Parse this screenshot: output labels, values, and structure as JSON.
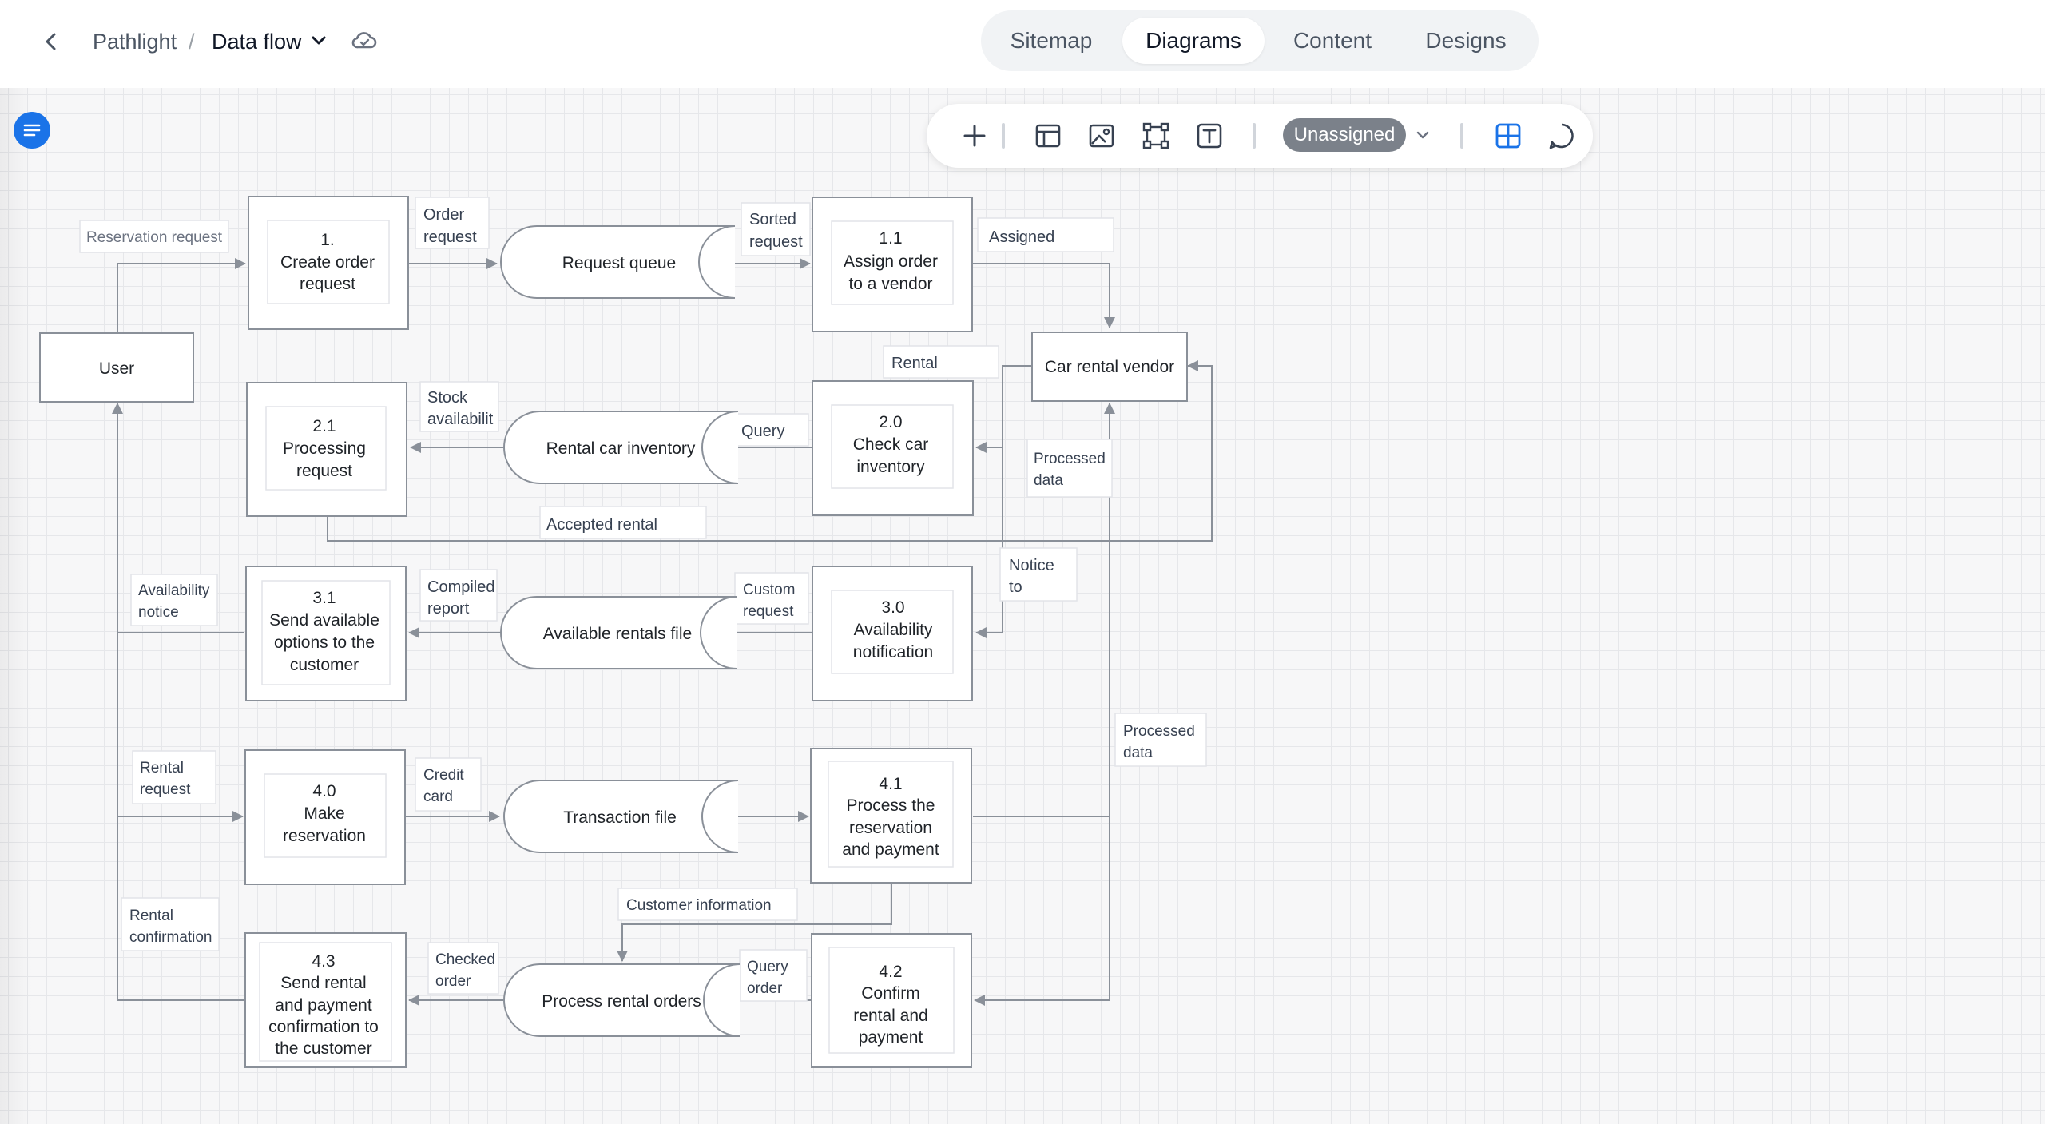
{
  "header": {
    "project": "Pathlight",
    "separator": "/",
    "current": "Data flow"
  },
  "tabs": [
    {
      "label": "Sitemap",
      "active": false
    },
    {
      "label": "Diagrams",
      "active": true
    },
    {
      "label": "Content",
      "active": false
    },
    {
      "label": "Designs",
      "active": false
    }
  ],
  "toolbar": {
    "assignee": "Unassigned",
    "icons": [
      "plus-icon",
      "layout-icon",
      "image-icon",
      "frame-icon",
      "text-icon",
      "grid-icon",
      "comment-icon"
    ]
  },
  "colors": {
    "accent": "#1a73e8",
    "edge": "#8a9099",
    "node_border": "#8a9099",
    "pill": "#7b818a"
  },
  "diagram": {
    "entities": {
      "user": "User",
      "vendor": "Car rental vendor"
    },
    "processes": {
      "p1": [
        "1.",
        "Create order",
        "request"
      ],
      "p11": [
        "1.1",
        "Assign order",
        "to a vendor"
      ],
      "p21": [
        "2.1",
        "Processing",
        "request"
      ],
      "p20": [
        "2.0",
        "Check car",
        "inventory"
      ],
      "p31": [
        "3.1",
        "Send available",
        "options to the",
        "customer"
      ],
      "p30": [
        "3.0",
        "Availability",
        "notification"
      ],
      "p40": [
        "4.0",
        "Make",
        "reservation"
      ],
      "p41": [
        "4.1",
        "Process the",
        "reservation",
        "and payment"
      ],
      "p43": [
        "4.3",
        "Send rental",
        "and payment",
        "confirmation to",
        "the customer"
      ],
      "p42": [
        "4.2",
        "Confirm",
        "rental and",
        "payment"
      ]
    },
    "stores": {
      "s1": "Request queue",
      "s2": "Rental car inventory",
      "s3": "Available rentals file",
      "s4": "Transaction file",
      "s5": "Process rental orders"
    },
    "labels": {
      "reservation_request": [
        "Reservation request"
      ],
      "order_request": [
        "Order",
        "request"
      ],
      "sorted_request": [
        "Sorted",
        "request"
      ],
      "assigned": [
        "Assigned"
      ],
      "rental": [
        "Rental"
      ],
      "stock_availability": [
        "Stock",
        "availabilit"
      ],
      "query": [
        "Query"
      ],
      "processed_data_1": [
        "Processed",
        "data"
      ],
      "accepted_rental": [
        "Accepted rental"
      ],
      "availability_notice": [
        "Availability",
        "notice"
      ],
      "compiled_report": [
        "Compiled",
        "report"
      ],
      "custom_request": [
        "Custom",
        "request"
      ],
      "notice_to": [
        "Notice",
        "to"
      ],
      "processed_data_2": [
        "Processed",
        "data"
      ],
      "rental_request": [
        "Rental",
        "request"
      ],
      "credit_card": [
        "Credit",
        "card"
      ],
      "customer_information": [
        "Customer information"
      ],
      "rental_confirmation": [
        "Rental",
        "confirmation"
      ],
      "checked_order": [
        "Checked",
        "order"
      ],
      "query_order": [
        "Query",
        "order"
      ]
    }
  }
}
